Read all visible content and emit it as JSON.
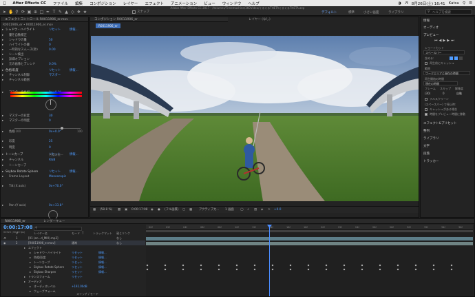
{
  "menubar": {
    "app_name": "After Effects CC",
    "items": [
      "ファイル",
      "編集",
      "コンポジション",
      "レイヤー",
      "エフェクト",
      "アニメーション",
      "ビュー",
      "ウィンドウ",
      "ヘルプ"
    ],
    "date_time": "8月26日(土) 16:41",
    "user": "Katsu"
  },
  "window_title": "Adobe After Effects CC 2017 - /Volumes/Timemachine/360Video/ぐるぐるTHETAぐるぐるTHETA.aep",
  "toolbar": {
    "snap_label": "スナップ",
    "workspaces": [
      "デフォルト",
      "標準",
      "小さい画面",
      "ライブラリ"
    ],
    "active_workspace": "デフォルト",
    "search_placeholder": "ヘルプを検索"
  },
  "effect_controls": {
    "tab_label": "エフェクトコントロール R0011906_er.mov",
    "header": "R0011906_er • R0011906_er.mov",
    "items": [
      {
        "label": "シャドウ・ハイライト",
        "value": "リセット",
        "extra": "情報..."
      },
      {
        "label": "量を自動補正",
        "value": ""
      },
      {
        "label": "シャドウの量",
        "value": "50"
      },
      {
        "label": "ハイライトの量",
        "value": "0"
      },
      {
        "label": "一時的なスムーズ(秒)",
        "value": "0.00"
      },
      {
        "label": "シーン検出",
        "value": ""
      },
      {
        "label": "詳細オプション",
        "value": ""
      },
      {
        "label": "元の画像とブレンド",
        "value": "0.0%"
      },
      {
        "label": "色相/彩度",
        "value": "リセット",
        "extra": "情報..."
      },
      {
        "label": "チャンネル制御",
        "value": "マスター"
      },
      {
        "label": "チャンネル範囲",
        "value": ""
      },
      {
        "label": "マスターの色相",
        "value": "0x+0.0°"
      },
      {
        "label": "マスターの彩度",
        "value": "30"
      },
      {
        "label": "マスターの明度",
        "value": "0"
      },
      {
        "label": "色相",
        "value": "0x+0.0°"
      },
      {
        "label": "彩度",
        "value": "25"
      },
      {
        "label": "明度",
        "value": "0"
      },
      {
        "label": "トーンカーブ",
        "value": "リセット",
        "extra": "情報..."
      },
      {
        "label": "チャンネル",
        "value": "RGB"
      },
      {
        "label": "トーンカーブ",
        "value": ""
      },
      {
        "label": "Skybox Rotate Sphere",
        "value": "リセット",
        "extra": "情報..."
      },
      {
        "label": "Frame Layout",
        "value": "Monoscopic"
      },
      {
        "label": "Tilt (X axis)",
        "value": "0x+70.0°"
      },
      {
        "label": "Pan (Y axis)",
        "value": "0x+33.8°"
      }
    ],
    "colorize_label": "色相の統一",
    "slider_min": "-100",
    "slider_max": "100"
  },
  "composition": {
    "tab_label": "コンポジション R0011906_er",
    "layer_tab": "レイヤー (なし)",
    "breadcrumb": "R0011906_er",
    "zoom": "(58.8 %)",
    "timecode": "0:00:17:08",
    "resolution": "(フル画質)",
    "camera": "アクティブカ...",
    "view": "1 画面",
    "exposure": "+0.0"
  },
  "right_panel": {
    "info": "情報",
    "audio": "オーディオ",
    "preview": "プレビュー",
    "shortcut_label": "ショートカット",
    "shortcut_value": "スペースバー",
    "include_label": "含める:",
    "cache_label": "再生前にキャッシュ",
    "range_label": "範囲",
    "range_value": "ワークエリアと現在の時間",
    "play_from_label": "再生開始の時間",
    "play_from_value": "現在の時間",
    "frame_label": "フレーム",
    "skip_label": "スキップ",
    "resolution_label": "解像度",
    "frame_value": "(30)",
    "skip_value": "0",
    "res_value": "自動",
    "fullscreen_label": "フルスクリーン",
    "on_stop_label": "(スペースバー) で停止時:",
    "cache_play_label": "キャッシュがある場合",
    "move_time_label": "時間をプレビュー時間に移動",
    "sections": [
      "エフェクト&プリセット",
      "整列",
      "ライブラリ",
      "文字",
      "段落",
      "トラッカー"
    ]
  },
  "timeline": {
    "tab_label": "R0011906_er",
    "render_queue": "レンダーキュー",
    "timecode": "0:00:17:08",
    "frame_info": "00520 (30.00 fps)",
    "columns": [
      "#",
      "レイヤー名",
      "モード",
      "T",
      "トラックマット",
      "親とリンク"
    ],
    "layers": [
      {
        "num": "1",
        "name": "[01 (en...d_MIX).mp3]",
        "mode": "",
        "parent": "なし"
      },
      {
        "num": "2",
        "name": "[R0011906_er.mov]",
        "mode": "通常",
        "parent": "なし"
      }
    ],
    "properties": [
      {
        "label": "エフェクト",
        "value": "",
        "info": ""
      },
      {
        "label": "シャドウ・ハイライト",
        "value": "リセット",
        "info": "情報..."
      },
      {
        "label": "色相/彩度",
        "value": "リセット",
        "info": "情報..."
      },
      {
        "label": "トーンカーブ",
        "value": "リセット",
        "info": "情報..."
      },
      {
        "label": "Skybox Rotate Sphere",
        "value": "リセット",
        "info": "情報..."
      },
      {
        "label": "Skybox Sharpen",
        "value": "リセット",
        "info": "情報..."
      },
      {
        "label": "トランスフォーム",
        "value": "リセット",
        "info": ""
      },
      {
        "label": "オーディオ",
        "value": "",
        "info": ""
      },
      {
        "label": "オーディオレベル",
        "value": "+192.00dB",
        "info": ""
      },
      {
        "label": "ウェーブフォーム",
        "value": "",
        "info": ""
      }
    ],
    "ruler": [
      "00f",
      "02f",
      "04f",
      "06f",
      "08f",
      "10f",
      "12f",
      "14f",
      "16f",
      "18f",
      "20f",
      "22f",
      "24f",
      "26f",
      "28f",
      "30f",
      "32f",
      "34f",
      "36f"
    ],
    "footer": "スイッチ / モード"
  },
  "colors": {
    "accent": "#4f9cff",
    "timecode": "#5aa9ff",
    "playhead": "#4b8dff"
  }
}
